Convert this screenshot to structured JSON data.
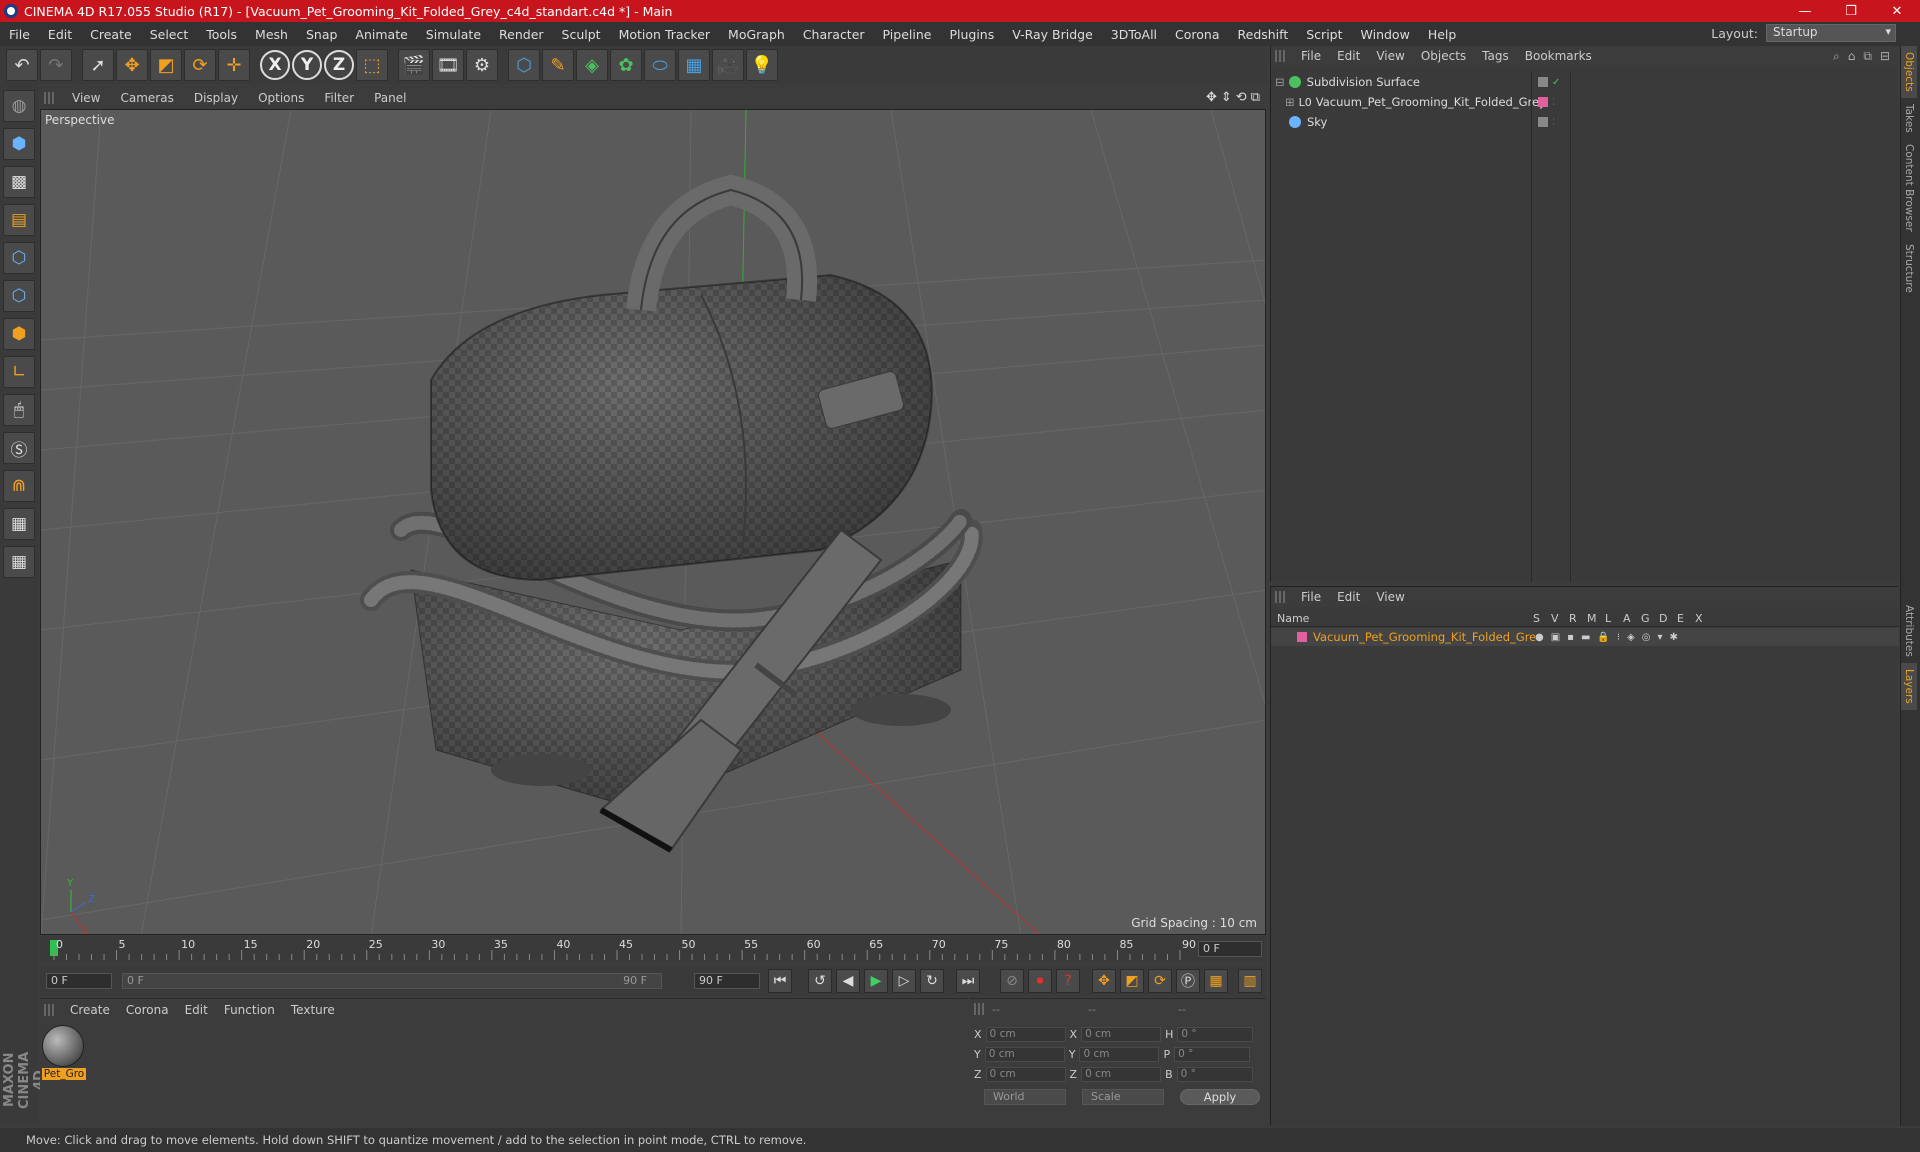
{
  "window": {
    "title": "CINEMA 4D R17.055 Studio (R17) - [Vacuum_Pet_Grooming_Kit_Folded_Grey_c4d_standart.c4d *] - Main",
    "controls": [
      "—",
      "❐",
      "✕"
    ]
  },
  "menubar": {
    "items": [
      "File",
      "Edit",
      "Create",
      "Select",
      "Tools",
      "Mesh",
      "Snap",
      "Animate",
      "Simulate",
      "Render",
      "Sculpt",
      "Motion Tracker",
      "MoGraph",
      "Character",
      "Pipeline",
      "Plugins",
      "V-Ray Bridge",
      "3DToAll",
      "Corona",
      "Redshift",
      "Script",
      "Window",
      "Help"
    ],
    "layout_label": "Layout:",
    "layout_value": "Startup"
  },
  "viewport": {
    "menu": [
      "View",
      "Cameras",
      "Display",
      "Options",
      "Filter",
      "Panel"
    ],
    "label": "Perspective",
    "grid_spacing": "Grid Spacing : 10 cm"
  },
  "timeline": {
    "ticks": [
      "0",
      "5",
      "10",
      "15",
      "20",
      "25",
      "30",
      "35",
      "40",
      "45",
      "50",
      "55",
      "60",
      "65",
      "70",
      "75",
      "80",
      "85",
      "90"
    ],
    "current_frame": "0 F",
    "start_field": "0 F",
    "range_start": "0 F",
    "range_end": "90 F",
    "end_field": "90 F"
  },
  "material_manager": {
    "menu": [
      "Create",
      "Corona",
      "Edit",
      "Function",
      "Texture"
    ],
    "materials": [
      {
        "name": "Pet_Gro"
      }
    ]
  },
  "coordinates": {
    "headers": [
      "--",
      "--",
      "--"
    ],
    "rows": [
      {
        "axis": "X",
        "pos": "0 cm",
        "axis2": "X",
        "size": "0 cm",
        "rot_axis": "H",
        "rot": "0 °"
      },
      {
        "axis": "Y",
        "pos": "0 cm",
        "axis2": "Y",
        "size": "0 cm",
        "rot_axis": "P",
        "rot": "0 °"
      },
      {
        "axis": "Z",
        "pos": "0 cm",
        "axis2": "Z",
        "size": "0 cm",
        "rot_axis": "B",
        "rot": "0 °"
      }
    ],
    "space": "World",
    "mode": "Scale",
    "apply": "Apply"
  },
  "object_manager": {
    "menu": [
      "File",
      "Edit",
      "View",
      "Objects",
      "Tags",
      "Bookmarks"
    ],
    "objects": [
      {
        "name": "Subdivision Surface",
        "color": "#4cc060"
      },
      {
        "name": "Vacuum_Pet_Grooming_Kit_Folded_Grey",
        "color": "#f0a020"
      },
      {
        "name": "Sky",
        "color": "#6ab4ff"
      }
    ]
  },
  "layer_manager": {
    "menu": [
      "File",
      "Edit",
      "View"
    ],
    "columns": [
      "Name",
      "S",
      "V",
      "R",
      "M",
      "L",
      "A",
      "G",
      "D",
      "E",
      "X"
    ],
    "layers": [
      {
        "name": "Vacuum_Pet_Grooming_Kit_Folded_Grey",
        "color": "#e060a0"
      }
    ]
  },
  "side_tabs": [
    "Objects",
    "Takes",
    "Content Browser",
    "Structure",
    "Attributes",
    "Layers"
  ],
  "status": "Move: Click and drag to move elements. Hold down SHIFT to quantize movement / add to the selection in point mode, CTRL to remove.",
  "brand": "MAXON CINEMA 4D"
}
